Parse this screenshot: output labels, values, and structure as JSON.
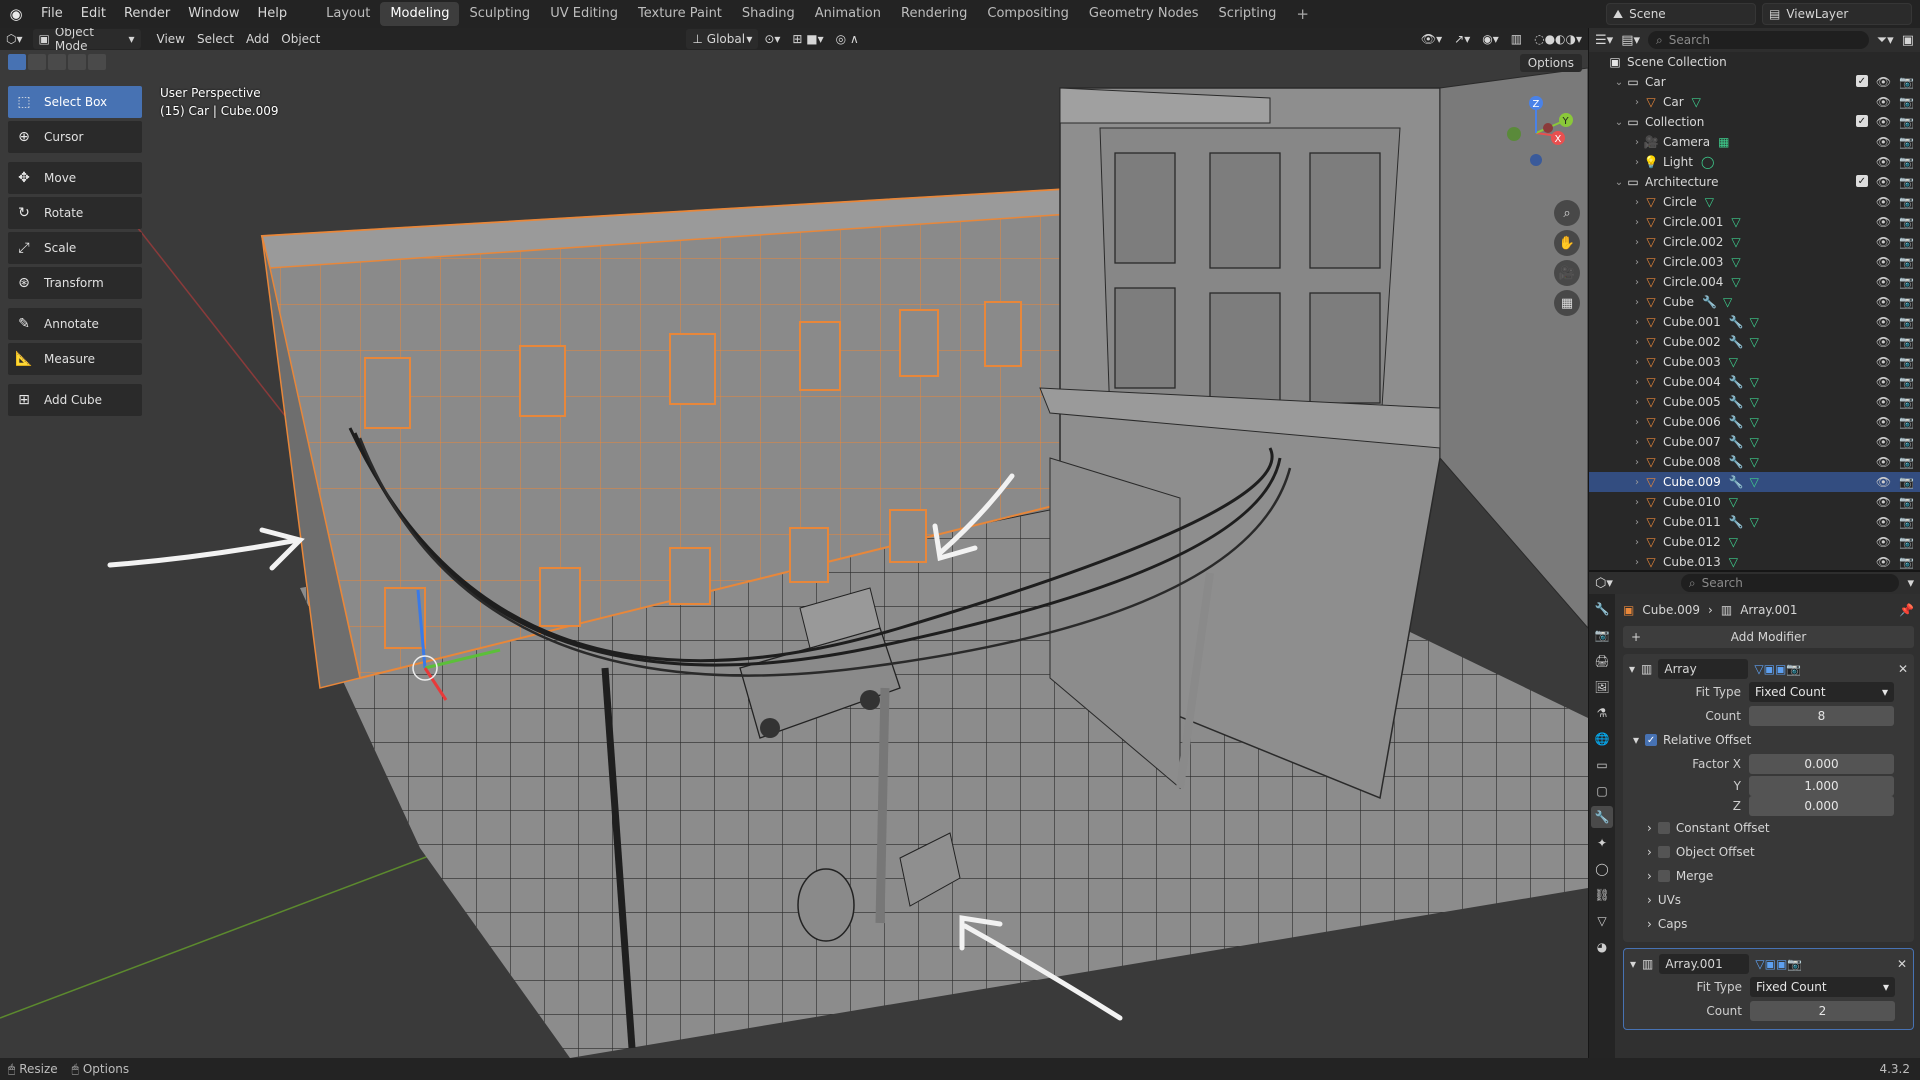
{
  "menu": [
    "File",
    "Edit",
    "Render",
    "Window",
    "Help"
  ],
  "workspaces": [
    "Layout",
    "Modeling",
    "Sculpting",
    "UV Editing",
    "Texture Paint",
    "Shading",
    "Animation",
    "Rendering",
    "Compositing",
    "Geometry Nodes",
    "Scripting"
  ],
  "active_workspace": "Modeling",
  "top_right": {
    "scene": "Scene",
    "view_layer": "ViewLayer"
  },
  "viewport": {
    "mode": "Object Mode",
    "menus": [
      "View",
      "Select",
      "Add",
      "Object"
    ],
    "orientation": "Global",
    "options": "Options",
    "info_line1": "User Perspective",
    "info_line2": "(15) Car | Cube.009"
  },
  "tools": [
    "Select Box",
    "Cursor",
    "Move",
    "Rotate",
    "Scale",
    "Transform",
    "Annotate",
    "Measure",
    "Add Cube"
  ],
  "outliner": {
    "search_placeholder": "Search",
    "rows": [
      {
        "label": "Scene Collection",
        "level": 0,
        "type": "scene"
      },
      {
        "label": "Car",
        "level": 1,
        "type": "collection"
      },
      {
        "label": "Car",
        "level": 2,
        "type": "mesh",
        "mods": "mesh"
      },
      {
        "label": "Collection",
        "level": 1,
        "type": "collection"
      },
      {
        "label": "Camera",
        "level": 2,
        "type": "camera",
        "mods": "camdata"
      },
      {
        "label": "Light",
        "level": 2,
        "type": "light",
        "mods": "lightdata"
      },
      {
        "label": "Architecture",
        "level": 1,
        "type": "collection"
      },
      {
        "label": "Circle",
        "level": 2,
        "type": "mesh",
        "mods": "mesh"
      },
      {
        "label": "Circle.001",
        "level": 2,
        "type": "mesh",
        "mods": "mesh"
      },
      {
        "label": "Circle.002",
        "level": 2,
        "type": "mesh",
        "mods": "mesh"
      },
      {
        "label": "Circle.003",
        "level": 2,
        "type": "mesh",
        "mods": "mesh"
      },
      {
        "label": "Circle.004",
        "level": 2,
        "type": "mesh",
        "mods": "mesh"
      },
      {
        "label": "Cube",
        "level": 2,
        "type": "mesh",
        "mods": "wrench+mesh"
      },
      {
        "label": "Cube.001",
        "level": 2,
        "type": "mesh",
        "mods": "wrench+mesh"
      },
      {
        "label": "Cube.002",
        "level": 2,
        "type": "mesh",
        "mods": "wrench+mesh"
      },
      {
        "label": "Cube.003",
        "level": 2,
        "type": "mesh",
        "mods": "mesh"
      },
      {
        "label": "Cube.004",
        "level": 2,
        "type": "mesh",
        "mods": "wrench+mesh"
      },
      {
        "label": "Cube.005",
        "level": 2,
        "type": "mesh",
        "mods": "wrench+mesh"
      },
      {
        "label": "Cube.006",
        "level": 2,
        "type": "mesh",
        "mods": "wrench+mesh"
      },
      {
        "label": "Cube.007",
        "level": 2,
        "type": "mesh",
        "mods": "wrench+mesh"
      },
      {
        "label": "Cube.008",
        "level": 2,
        "type": "mesh",
        "mods": "wrench+mesh"
      },
      {
        "label": "Cube.009",
        "level": 2,
        "type": "mesh",
        "mods": "wrench+mesh",
        "selected": true
      },
      {
        "label": "Cube.010",
        "level": 2,
        "type": "mesh",
        "mods": "mesh"
      },
      {
        "label": "Cube.011",
        "level": 2,
        "type": "mesh",
        "mods": "wrench+mesh"
      },
      {
        "label": "Cube.012",
        "level": 2,
        "type": "mesh",
        "mods": "mesh"
      },
      {
        "label": "Cube.013",
        "level": 2,
        "type": "mesh",
        "mods": "mesh"
      }
    ]
  },
  "properties": {
    "search_placeholder": "Search",
    "object": "Cube.009",
    "modifier_crumb": "Array.001",
    "add_modifier": "Add Modifier",
    "mod1": {
      "name": "Array",
      "fit_type_label": "Fit Type",
      "fit_type": "Fixed Count",
      "count_label": "Count",
      "count": "8",
      "relative_offset": "Relative Offset",
      "factor_x_label": "Factor X",
      "factor_x": "0.000",
      "y_label": "Y",
      "y": "1.000",
      "z_label": "Z",
      "z": "0.000",
      "constant_offset": "Constant Offset",
      "object_offset": "Object Offset",
      "merge": "Merge",
      "uvs": "UVs",
      "caps": "Caps"
    },
    "mod2": {
      "name": "Array.001",
      "fit_type_label": "Fit Type",
      "fit_type": "Fixed Count",
      "count_label": "Count",
      "count": "2"
    }
  },
  "status": {
    "resize": "Resize",
    "options": "Options",
    "version": "4.3.2"
  }
}
